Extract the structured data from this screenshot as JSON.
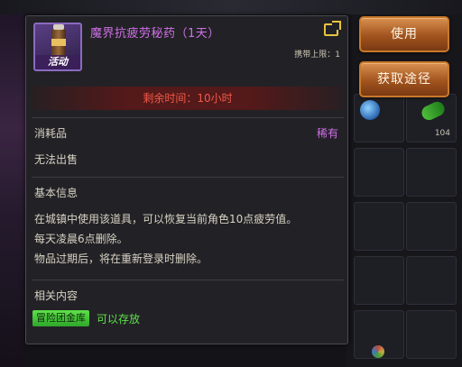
{
  "item": {
    "name": "魔界抗疲劳秘药（1天）",
    "event_tag": "活动",
    "carry_limit": "携带上限：1",
    "remaining_time": "剩余时间：10小时",
    "category": "消耗品",
    "rarity": "稀有",
    "trade": "无法出售",
    "basic_info_title": "基本信息",
    "description_lines": [
      "在城镇中使用该道具，可以恢复当前角色10点疲劳值。",
      "每天凌晨6点删除。",
      "物品过期后，将在重新登录时删除。"
    ],
    "related_title": "相关内容",
    "guild_storage_tag": "冒险团金库",
    "can_store": "可以存放",
    "icon": "potion-bottle-icon"
  },
  "actions": {
    "use_label": "使用",
    "obtain_label": "获取途径"
  },
  "inventory": {
    "stack_count": "104"
  },
  "colors": {
    "item_name": "#d070e8",
    "remaining_time": "#f05a4a",
    "guild_tag": "#5fe04a",
    "button": "#a2541e"
  }
}
